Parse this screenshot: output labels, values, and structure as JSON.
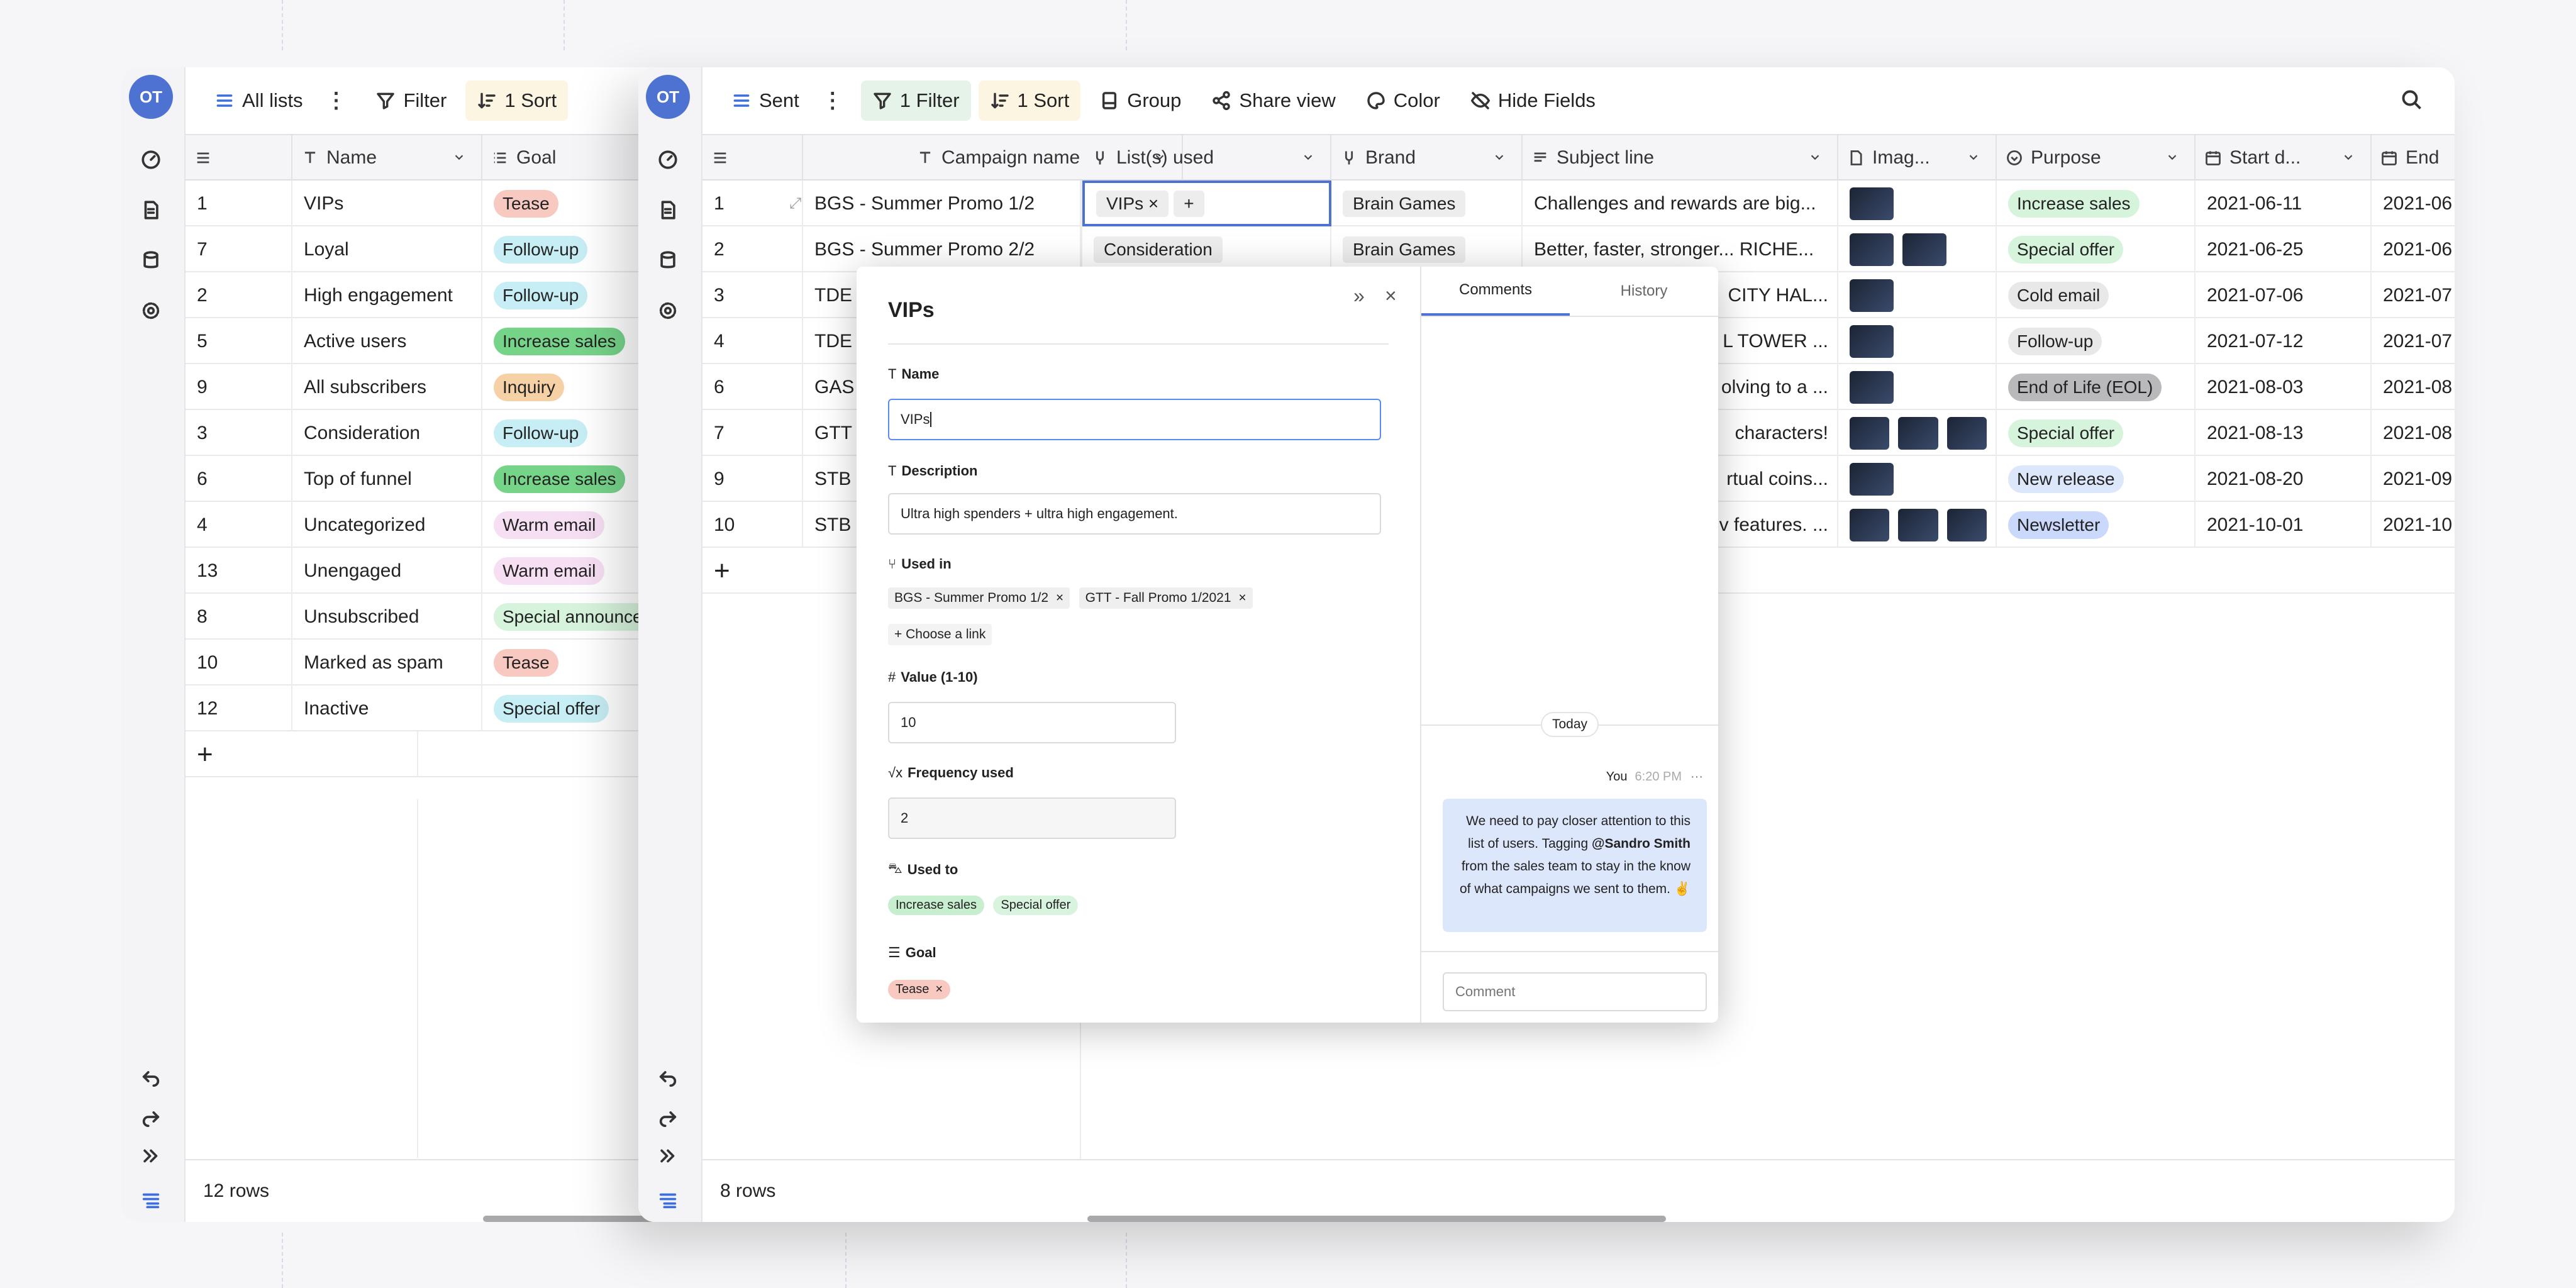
{
  "left_window": {
    "avatar": "OT",
    "toolbar": {
      "view": "All lists",
      "filter": "Filter",
      "sort": "1 Sort"
    },
    "columns": [
      "Name",
      "Goal"
    ],
    "rows": [
      {
        "n": "1",
        "name": "VIPs",
        "goal": "Tease",
        "c": "p-red"
      },
      {
        "n": "7",
        "name": "Loyal",
        "goal": "Follow-up",
        "c": "p-cyan"
      },
      {
        "n": "2",
        "name": "High engagement",
        "goal": "Follow-up",
        "c": "p-cyan"
      },
      {
        "n": "5",
        "name": "Active users",
        "goal": "Increase sales",
        "c": "p-green"
      },
      {
        "n": "9",
        "name": "All subscribers",
        "goal": "Inquiry",
        "c": "p-orange"
      },
      {
        "n": "3",
        "name": "Consideration",
        "goal": "Follow-up",
        "c": "p-cyan"
      },
      {
        "n": "6",
        "name": "Top of funnel",
        "goal": "Increase sales",
        "c": "p-green"
      },
      {
        "n": "4",
        "name": "Uncategorized",
        "goal": "Warm email",
        "c": "p-pink"
      },
      {
        "n": "13",
        "name": "Unengaged",
        "goal": "Warm email",
        "c": "p-pink"
      },
      {
        "n": "8",
        "name": "Unsubscribed",
        "goal": "Special announce",
        "c": "p-lgreen"
      },
      {
        "n": "10",
        "name": "Marked as spam",
        "goal": "Tease",
        "c": "p-red"
      },
      {
        "n": "12",
        "name": "Inactive",
        "goal": "Special offer",
        "c": "p-cyan"
      }
    ],
    "footer": "12 rows"
  },
  "right_window": {
    "avatar": "OT",
    "toolbar": {
      "view": "Sent",
      "filter": "1 Filter",
      "sort": "1 Sort",
      "group": "Group",
      "share": "Share view",
      "color": "Color",
      "hide": "Hide Fields"
    },
    "columns": [
      "Campaign name",
      "List(s) used",
      "Brand",
      "Subject line",
      "Imag...",
      "Purpose",
      "Start d...",
      "End"
    ],
    "rows": [
      {
        "n": "1",
        "name": "BGS - Summer Promo 1/2",
        "list": "VIPs",
        "brand": "Brain Games",
        "subject": "Challenges and rewards are big...",
        "thumbs": 1,
        "purpose": "Increase sales",
        "pc": "p-lgreen",
        "start": "2021-06-11",
        "end": "2021-06"
      },
      {
        "n": "2",
        "name": "BGS - Summer Promo 2/2",
        "list": "Consideration",
        "brand": "Brain Games",
        "subject": "Better, faster, stronger... RICHE...",
        "thumbs": 2,
        "purpose": "Special offer",
        "pc": "p-lgreen",
        "start": "2021-06-25",
        "end": "2021-06"
      },
      {
        "n": "3",
        "name": "TDE",
        "list": "",
        "brand": "",
        "subject": "CITY HAL...",
        "thumbs": 1,
        "purpose": "Cold email",
        "pc": "p-gray",
        "start": "2021-07-06",
        "end": "2021-07"
      },
      {
        "n": "4",
        "name": "TDE",
        "list": "",
        "brand": "",
        "subject": "L TOWER ...",
        "thumbs": 1,
        "purpose": "Follow-up",
        "pc": "p-gray",
        "start": "2021-07-12",
        "end": "2021-07"
      },
      {
        "n": "6",
        "name": "GAS",
        "list": "",
        "brand": "",
        "subject": "olving to a ...",
        "thumbs": 1,
        "purpose": "End of Life (EOL)",
        "pc": "p-dgray",
        "start": "2021-08-03",
        "end": "2021-08"
      },
      {
        "n": "7",
        "name": "GTT",
        "list": "",
        "brand": "",
        "subject": "characters!",
        "thumbs": 3,
        "purpose": "Special offer",
        "pc": "p-lgreen",
        "start": "2021-08-13",
        "end": "2021-08"
      },
      {
        "n": "9",
        "name": "STB",
        "list": "",
        "brand": "",
        "subject": "rtual coins...",
        "thumbs": 1,
        "purpose": "New release",
        "pc": "p-lblue",
        "start": "2021-08-20",
        "end": "2021-09"
      },
      {
        "n": "10",
        "name": "STB",
        "list": "",
        "brand": "",
        "subject": "v features. ...",
        "thumbs": 3,
        "purpose": "Newsletter",
        "pc": "p-blue",
        "start": "2021-10-01",
        "end": "2021-10"
      }
    ],
    "footer": "8 rows"
  },
  "modal": {
    "title": "VIPs",
    "name_label": "Name",
    "name_value": "VIPs",
    "desc_label": "Description",
    "desc_value": "Ultra high spenders + ultra high engagement.",
    "usedin_label": "Used in",
    "usedin": [
      "BGS - Summer Promo 1/2",
      "GTT - Fall Promo 1/2021"
    ],
    "choose_link": "Choose a link",
    "value_label": "Value (1-10)",
    "value": "10",
    "freq_label": "Frequency used",
    "freq": "2",
    "usedto_label": "Used to",
    "usedto": [
      "Increase sales",
      "Special offer"
    ],
    "goal_label": "Goal",
    "goal": "Tease",
    "tabs": [
      "Comments",
      "History"
    ],
    "today": "Today",
    "author": "You",
    "time": "6:20 PM",
    "comment_pre": "We need to pay closer attention to this list of users. Tagging ",
    "mention": "@Sandro Smith",
    "comment_post": " from the sales team to stay in the know of what campaigns we sent to them. ✌",
    "comment_placeholder": "Comment"
  }
}
